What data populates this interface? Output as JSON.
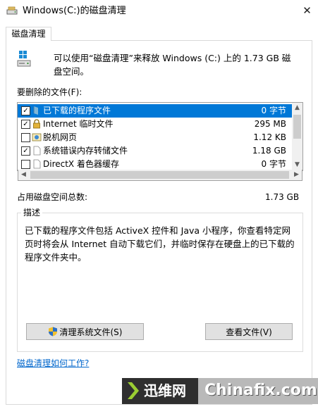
{
  "window": {
    "title": "Windows(C:)的磁盘清理",
    "close_glyph": "✕"
  },
  "tab": {
    "label": "磁盘清理"
  },
  "intro": {
    "text": "可以使用“磁盘清理”来释放 Windows (C:) 上的 1.73 GB 磁盘空间。"
  },
  "files_label": "要删除的文件(F):",
  "files": [
    {
      "name": "已下载的程序文件",
      "size": "0 字节",
      "checked": true,
      "selected": true,
      "icon": "folder-icon"
    },
    {
      "name": "Internet 临时文件",
      "size": "295 MB",
      "checked": true,
      "selected": false,
      "icon": "lock-icon"
    },
    {
      "name": "脱机网页",
      "size": "1.12 KB",
      "checked": false,
      "selected": false,
      "icon": "offline-page-icon"
    },
    {
      "name": "系统错误内存转储文件",
      "size": "1.18 GB",
      "checked": true,
      "selected": false,
      "icon": "file-icon"
    },
    {
      "name": "DirectX 着色器缓存",
      "size": "0 字节",
      "checked": false,
      "selected": false,
      "icon": "file-icon"
    }
  ],
  "total": {
    "label": "占用磁盘空间总数:",
    "value": "1.73 GB"
  },
  "description": {
    "title": "描述",
    "text": "已下载的程序文件包括 ActiveX 控件和 Java 小程序，你查看特定网页时将会从 Internet 自动下载它们，并临时保存在硬盘上的已下载的程序文件夹中。"
  },
  "buttons": {
    "clean_system": "清理系统文件(S)",
    "view_files": "查看文件(V)"
  },
  "help_link": "磁盘清理如何工作?",
  "watermark": {
    "cn": "迅维网",
    "en": "Chinafix.com"
  },
  "colors": {
    "selection": "#0078d7",
    "link": "#0066cc",
    "accent": "#0078d7"
  }
}
